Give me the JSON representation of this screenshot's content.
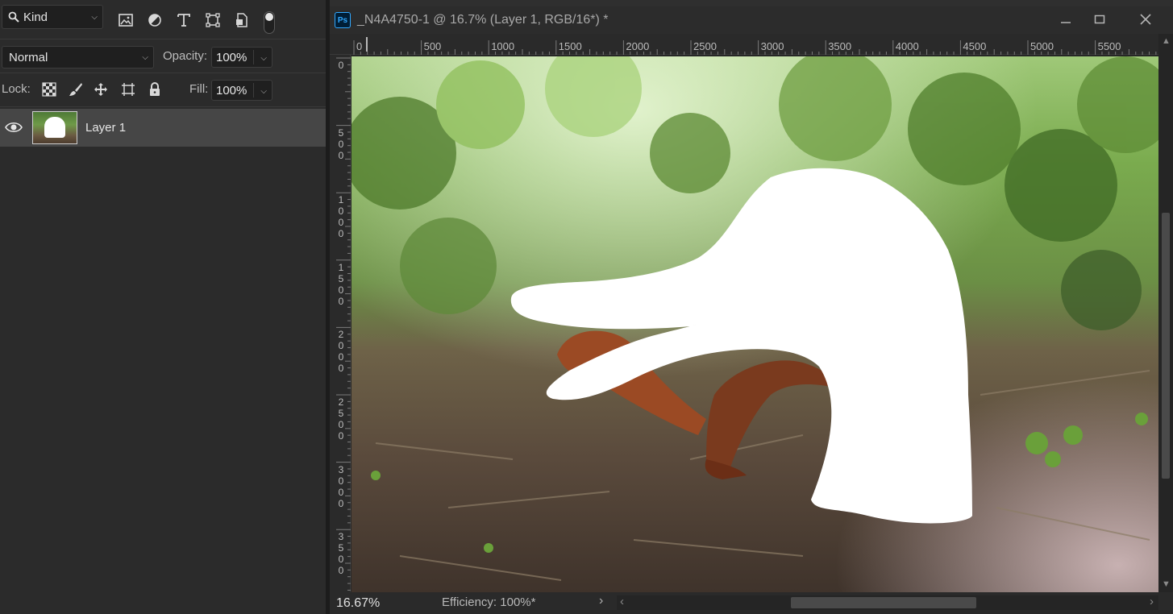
{
  "layers_panel": {
    "filter": {
      "kind_label": "Kind"
    },
    "blend_mode": "Normal",
    "opacity": {
      "label": "Opacity:",
      "value": "100%"
    },
    "lock": {
      "label": "Lock:"
    },
    "fill": {
      "label": "Fill:",
      "value": "100%"
    },
    "layers": [
      {
        "name": "Layer 1",
        "visible": true
      }
    ]
  },
  "document": {
    "app_badge": "Ps",
    "title": "_N4A4750-1 @ 16.7% (Layer 1, RGB/16*) *",
    "h_ruler_labels": [
      "0",
      "500",
      "1000",
      "1500",
      "2000",
      "2500",
      "3000",
      "3500",
      "4000",
      "4500",
      "5000",
      "5500"
    ],
    "v_ruler_labels": [
      "0",
      "500",
      "1000",
      "1500",
      "2000",
      "2500",
      "3000",
      "3500"
    ]
  },
  "status": {
    "zoom": "16.67%",
    "efficiency": "Efficiency: 100%*"
  },
  "colors": {
    "panel_bg": "#2b2b2b",
    "selected_layer": "#464646",
    "ps_blue": "#31a8ff"
  }
}
